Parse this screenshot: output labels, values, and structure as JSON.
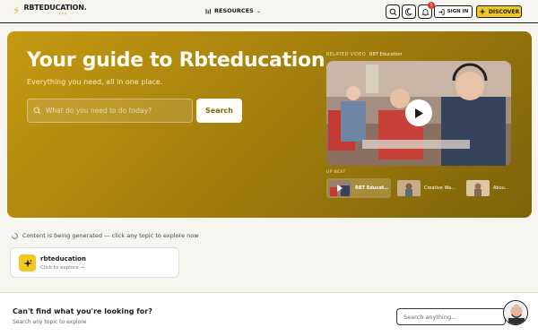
{
  "header": {
    "logo_text": "RBTEDUCATION.",
    "logo_sub": "⚡⚡⚡",
    "nav_resources": "RESOURCES",
    "notification_count": "1",
    "signin_label": "SIGN IN",
    "discover_label": "DISCOVER"
  },
  "hero": {
    "title": "Your guide to Rbteducation",
    "subtitle": "Everything you need, all in one place.",
    "search_placeholder": "What do you need to do today?",
    "search_button": "Search",
    "video_label": "RELATED VIDEO",
    "video_title": "RBT Education",
    "up_next_label": "UP NEXT",
    "thumbnails": [
      {
        "title": "RBT Education",
        "active": true
      },
      {
        "title": "Creative Ways B..."
      },
      {
        "title": "Abou..."
      }
    ]
  },
  "status": {
    "text": "Content is being generated — click any topic to explore now"
  },
  "topic_card": {
    "title": "rbteducation",
    "link": "Click to explore →"
  },
  "footer": {
    "title": "Can't find what you're looking for?",
    "subtitle": "Search any topic to explore",
    "search_placeholder": "Search anything..."
  },
  "colors": {
    "accent": "#f2c81e",
    "hero": "#a5800d",
    "background": "#f6f5f0"
  }
}
